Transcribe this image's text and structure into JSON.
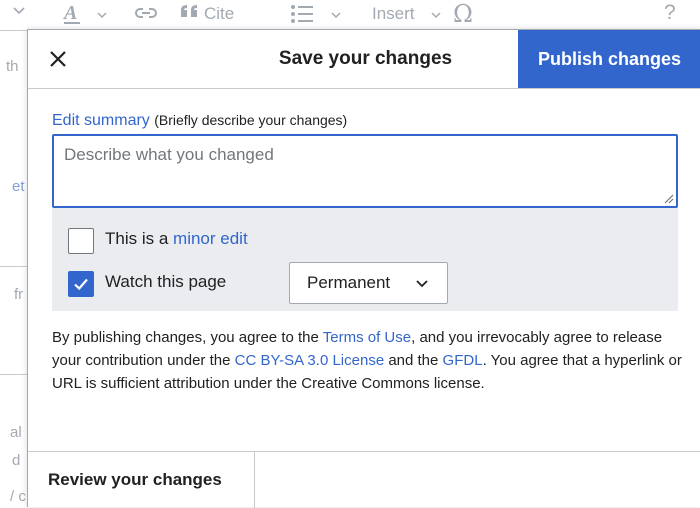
{
  "toolbar": {
    "cite_label": "Cite",
    "insert_label": "Insert",
    "help_glyph": "?",
    "icons": [
      "chevron-down-icon",
      "text-style-icon",
      "link-icon",
      "cite-quote-icon",
      "bullet-list-icon",
      "special-character-icon",
      "help-icon"
    ]
  },
  "background_text": {
    "t1": "th",
    "t2": "et",
    "t3": "fr",
    "t4": "al",
    "t5": "d",
    "t6": "/ c"
  },
  "dialog": {
    "title": "Save your changes",
    "publish_label": "Publish changes",
    "summary": {
      "label_link": "Edit summary",
      "label_hint": "(Briefly describe your changes)",
      "placeholder": "Describe what you changed",
      "value": ""
    },
    "minor_edit": {
      "prefix": "This is a ",
      "link": "minor edit",
      "checked": false
    },
    "watch_page": {
      "label": "Watch this page",
      "checked": true,
      "duration": "Permanent"
    },
    "legal": {
      "p1": "By publishing changes, you agree to the ",
      "terms": "Terms of Use",
      "p2": ", and you irrevocably agree to release your contribution under the ",
      "license": "CC BY-SA 3.0 License",
      "p3": " and the ",
      "gfdl": "GFDL",
      "p4": ". You agree that a hyperlink or URL is sufficient attribution under the Creative Commons license."
    },
    "review_label": "Review your changes"
  },
  "colors": {
    "accent": "#3366cc",
    "options_bg": "#eaecf0",
    "border": "#c8ccd1",
    "disabled_text": "#a2a9b1"
  }
}
